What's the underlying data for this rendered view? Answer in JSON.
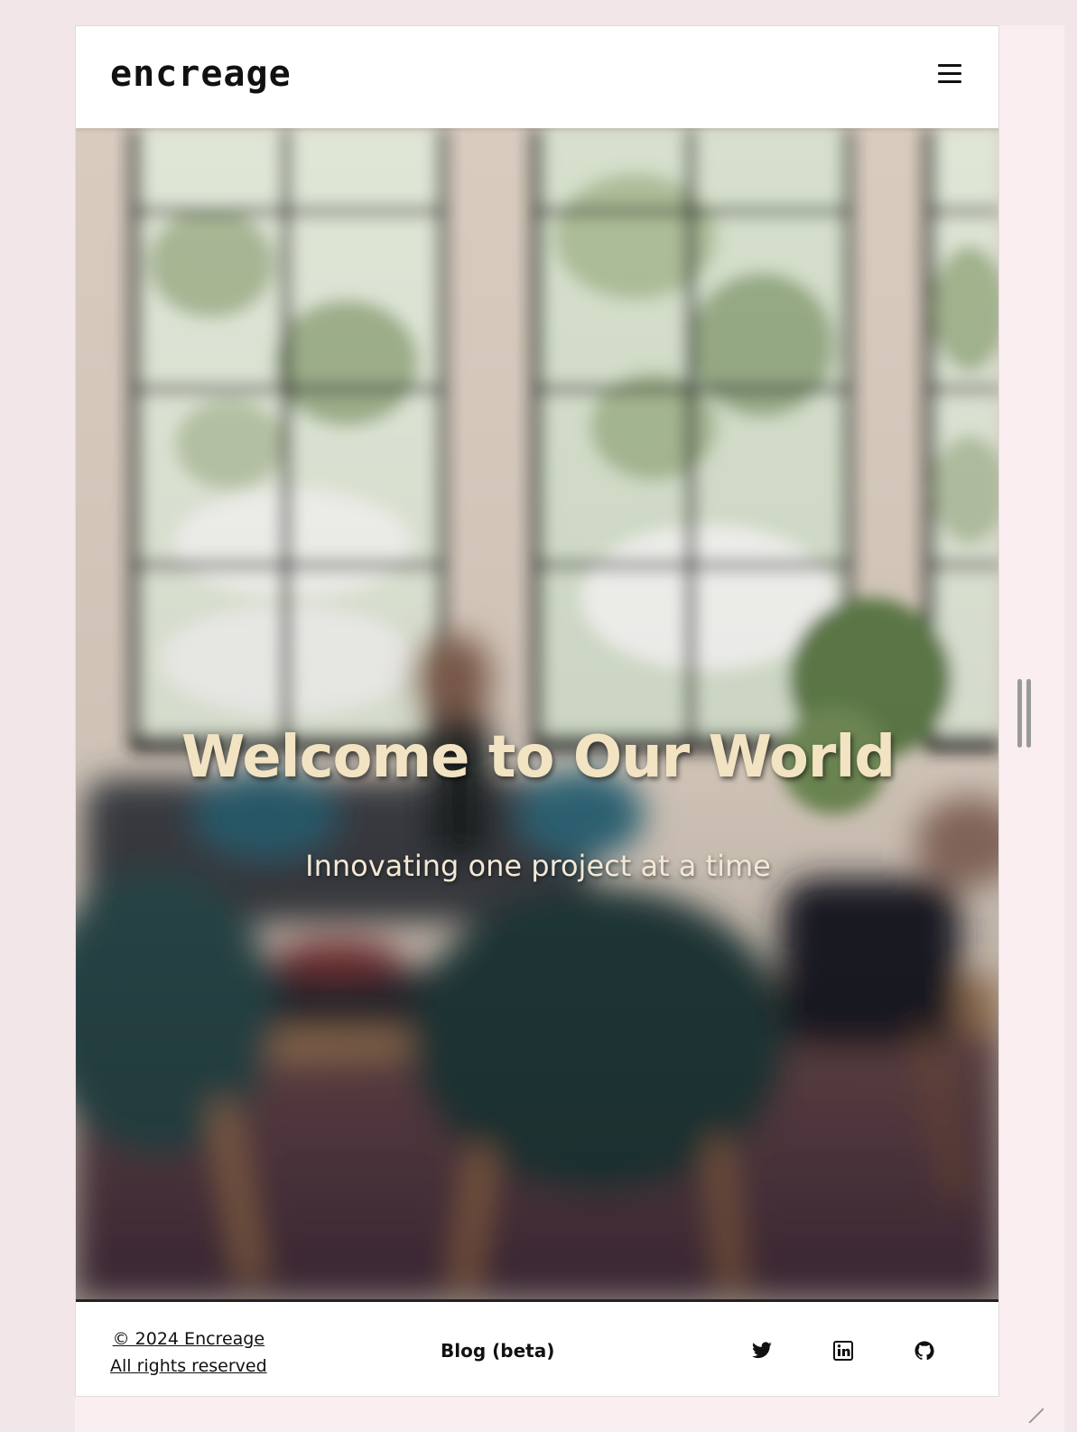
{
  "header": {
    "logo": "encreage",
    "menu_icon": "hamburger-menu-icon"
  },
  "hero": {
    "title": "Welcome to Our World",
    "subtitle": "Innovating one project at a time",
    "title_color": "#f2e4c3"
  },
  "footer": {
    "copyright_line1": "© 2024 Encreage",
    "copyright_line2": "All rights reserved",
    "blog_link": "Blog (beta)",
    "social_icons": [
      "twitter-icon",
      "linkedin-icon",
      "github-icon"
    ]
  },
  "colors": {
    "page_background": "#f3e6e8",
    "header_background": "#ffffff",
    "text": "#111111"
  }
}
